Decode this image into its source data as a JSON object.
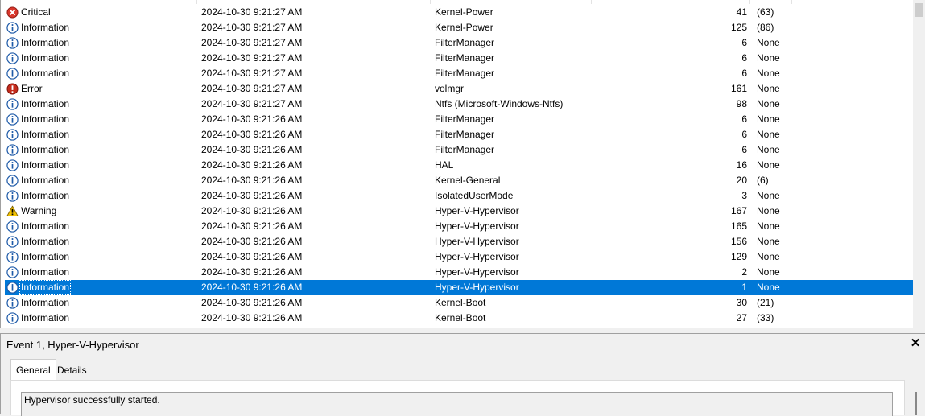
{
  "events": [
    {
      "level": "Critical",
      "icon": "critical-icon",
      "date": "2024-10-30 9:21:27 AM",
      "source": "Kernel-Power",
      "event_id": "41",
      "task": "(63)"
    },
    {
      "level": "Information",
      "icon": "information-icon",
      "date": "2024-10-30 9:21:27 AM",
      "source": "Kernel-Power",
      "event_id": "125",
      "task": "(86)"
    },
    {
      "level": "Information",
      "icon": "information-icon",
      "date": "2024-10-30 9:21:27 AM",
      "source": "FilterManager",
      "event_id": "6",
      "task": "None"
    },
    {
      "level": "Information",
      "icon": "information-icon",
      "date": "2024-10-30 9:21:27 AM",
      "source": "FilterManager",
      "event_id": "6",
      "task": "None"
    },
    {
      "level": "Information",
      "icon": "information-icon",
      "date": "2024-10-30 9:21:27 AM",
      "source": "FilterManager",
      "event_id": "6",
      "task": "None"
    },
    {
      "level": "Error",
      "icon": "error-icon",
      "date": "2024-10-30 9:21:27 AM",
      "source": "volmgr",
      "event_id": "161",
      "task": "None"
    },
    {
      "level": "Information",
      "icon": "information-icon",
      "date": "2024-10-30 9:21:27 AM",
      "source": "Ntfs (Microsoft-Windows-Ntfs)",
      "event_id": "98",
      "task": "None"
    },
    {
      "level": "Information",
      "icon": "information-icon",
      "date": "2024-10-30 9:21:26 AM",
      "source": "FilterManager",
      "event_id": "6",
      "task": "None"
    },
    {
      "level": "Information",
      "icon": "information-icon",
      "date": "2024-10-30 9:21:26 AM",
      "source": "FilterManager",
      "event_id": "6",
      "task": "None"
    },
    {
      "level": "Information",
      "icon": "information-icon",
      "date": "2024-10-30 9:21:26 AM",
      "source": "FilterManager",
      "event_id": "6",
      "task": "None"
    },
    {
      "level": "Information",
      "icon": "information-icon",
      "date": "2024-10-30 9:21:26 AM",
      "source": "HAL",
      "event_id": "16",
      "task": "None"
    },
    {
      "level": "Information",
      "icon": "information-icon",
      "date": "2024-10-30 9:21:26 AM",
      "source": "Kernel-General",
      "event_id": "20",
      "task": "(6)"
    },
    {
      "level": "Information",
      "icon": "information-icon",
      "date": "2024-10-30 9:21:26 AM",
      "source": "IsolatedUserMode",
      "event_id": "3",
      "task": "None"
    },
    {
      "level": "Warning",
      "icon": "warning-icon",
      "date": "2024-10-30 9:21:26 AM",
      "source": "Hyper-V-Hypervisor",
      "event_id": "167",
      "task": "None"
    },
    {
      "level": "Information",
      "icon": "information-icon",
      "date": "2024-10-30 9:21:26 AM",
      "source": "Hyper-V-Hypervisor",
      "event_id": "165",
      "task": "None"
    },
    {
      "level": "Information",
      "icon": "information-icon",
      "date": "2024-10-30 9:21:26 AM",
      "source": "Hyper-V-Hypervisor",
      "event_id": "156",
      "task": "None"
    },
    {
      "level": "Information",
      "icon": "information-icon",
      "date": "2024-10-30 9:21:26 AM",
      "source": "Hyper-V-Hypervisor",
      "event_id": "129",
      "task": "None"
    },
    {
      "level": "Information",
      "icon": "information-icon",
      "date": "2024-10-30 9:21:26 AM",
      "source": "Hyper-V-Hypervisor",
      "event_id": "2",
      "task": "None"
    },
    {
      "level": "Information",
      "icon": "information-icon",
      "date": "2024-10-30 9:21:26 AM",
      "source": "Hyper-V-Hypervisor",
      "event_id": "1",
      "task": "None",
      "selected": true
    },
    {
      "level": "Information",
      "icon": "information-icon",
      "date": "2024-10-30 9:21:26 AM",
      "source": "Kernel-Boot",
      "event_id": "30",
      "task": "(21)"
    },
    {
      "level": "Information",
      "icon": "information-icon",
      "date": "2024-10-30 9:21:26 AM",
      "source": "Kernel-Boot",
      "event_id": "27",
      "task": "(33)"
    }
  ],
  "details": {
    "title": "Event 1, Hyper-V-Hypervisor",
    "close_glyph": "✕",
    "tabs": [
      {
        "label": "General",
        "active": true
      },
      {
        "label": "Details",
        "active": false
      }
    ],
    "description": "Hypervisor successfully started."
  },
  "colors": {
    "selection": "#0078d7",
    "critical": "#d9372c",
    "error": "#c42b1c",
    "information": "#1e5aa8",
    "warning": "#f2c200"
  }
}
